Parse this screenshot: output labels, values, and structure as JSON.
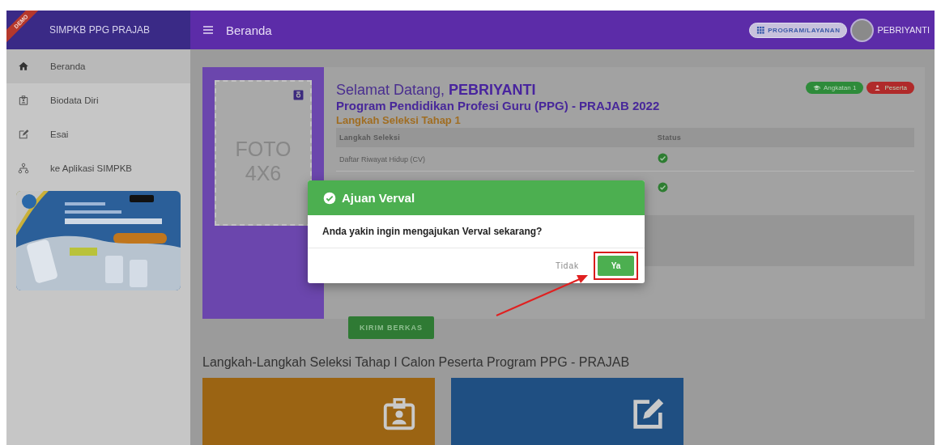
{
  "brand": {
    "ribbon": "DEMO",
    "title": "SIMPKB PPG PRAJAB"
  },
  "topbar": {
    "title": "Beranda",
    "program_button": "PROGRAM/LAYANAN",
    "user": "PEBRIYANTI"
  },
  "sidebar": {
    "items": [
      {
        "label": "Beranda",
        "selected": true
      },
      {
        "label": "Biodata Diri",
        "selected": false
      },
      {
        "label": "Esai",
        "selected": false
      },
      {
        "label": "ke Aplikasi SIMPKB",
        "selected": false
      }
    ]
  },
  "welcome": {
    "photo_lines": [
      "FOTO",
      "4X6"
    ],
    "greeting": "Selamat Datang, **PEBRIYANTI**",
    "program": "Program Pendidikan Profesi Guru (PPG) - PRAJAB 2022",
    "stage": "Langkah Seleksi Tahap 1",
    "badges": [
      {
        "label": "Angkatan 1",
        "color": "#2e8b3a"
      },
      {
        "label": "Peserta",
        "color": "#b02a2a"
      }
    ],
    "table": {
      "columns": [
        "Langkah Seleksi",
        "Status"
      ],
      "rows": [
        {
          "step": "Daftar Riwayat Hidup (CV)",
          "done": true
        },
        {
          "done": true
        }
      ]
    },
    "submit_button": "KIRIM BERKAS"
  },
  "section_title": "Langkah-Langkah Seleksi Tahap I Calon Peserta Program PPG - PRAJAB",
  "tiles": [
    {
      "color": "#9b6413"
    },
    {
      "color": "#1f4f82"
    }
  ],
  "dialog": {
    "title": "Ajuan Verval",
    "message": "Anda yakin ingin mengajukan Verval sekarang?",
    "buttons": [
      {
        "label": "Tidak",
        "kind": "text",
        "highlighted": false
      },
      {
        "label": "Ya",
        "kind": "primary",
        "highlighted": true
      }
    ]
  }
}
